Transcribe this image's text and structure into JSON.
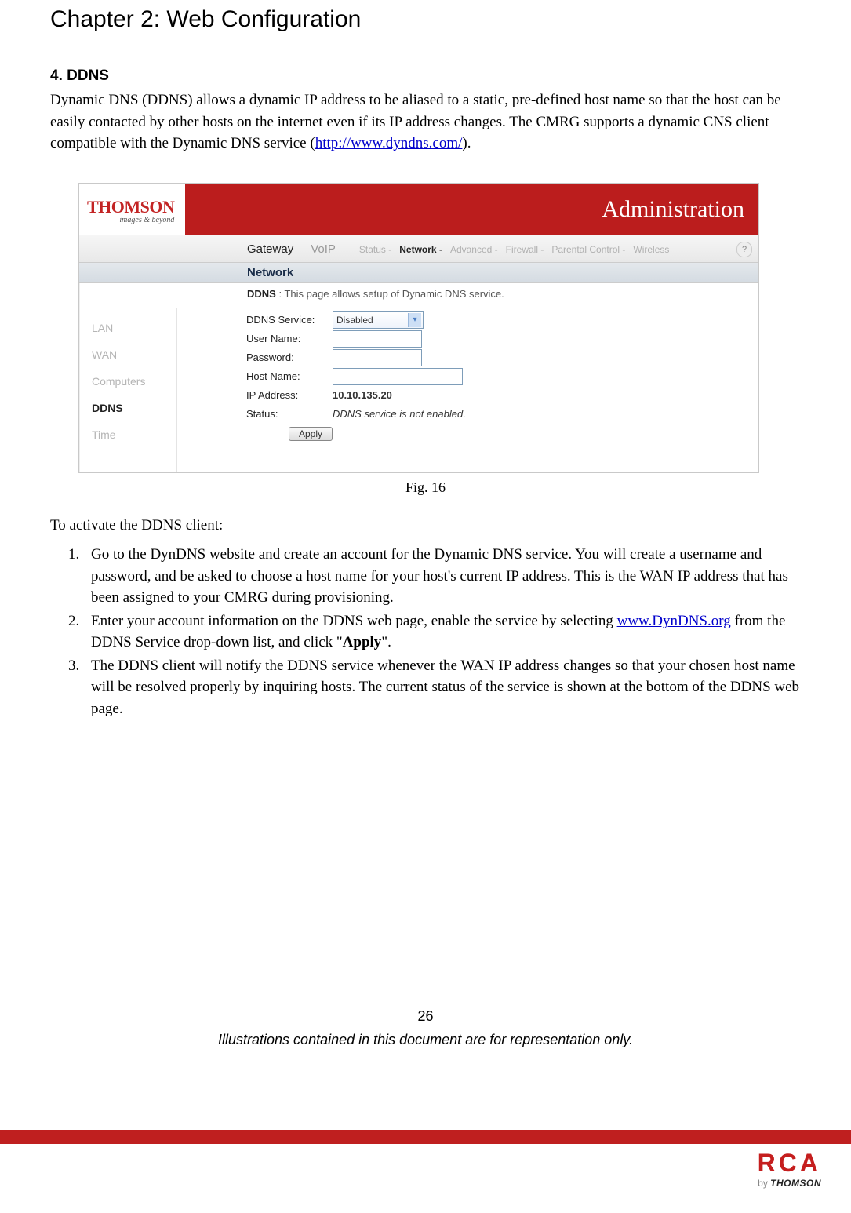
{
  "chapter_title": "Chapter 2: Web Configuration",
  "section_title": "4. DDNS",
  "para_intro_pre": "Dynamic DNS (DDNS) allows a dynamic IP address to be aliased to a static, pre-defined host name so that the host can be easily contacted by other hosts on the internet even if its IP address changes.    The CMRG supports a dynamic CNS client compatible with the Dynamic DNS service (",
  "para_intro_link": "http://www.dyndns.com/",
  "para_intro_post": ").",
  "fig": {
    "logo_main": "THOMSON",
    "logo_sub": "images & beyond",
    "admin_title": "Administration",
    "top_tabs": {
      "gateway": "Gateway",
      "voip": "VoIP"
    },
    "sub_tabs": {
      "status": "Status -",
      "network": "Network -",
      "advanced": "Advanced -",
      "firewall": "Firewall -",
      "parental": "Parental Control -",
      "wireless": "Wireless"
    },
    "help_label": "?",
    "section_banner": "Network",
    "desc_bold": "DDNS",
    "desc_rest": " :  This page allows setup of Dynamic DNS service.",
    "leftnav": {
      "lan": "LAN",
      "wan": "WAN",
      "computers": "Computers",
      "ddns": "DDNS",
      "time": "Time"
    },
    "form": {
      "ddns_service_label": "DDNS Service:",
      "ddns_service_value": "Disabled",
      "user_name_label": "User Name:",
      "user_name_value": "",
      "password_label": "Password:",
      "password_value": "",
      "host_name_label": "Host Name:",
      "host_name_value": "",
      "ip_address_label": "IP Address:",
      "ip_address_value": "10.10.135.20",
      "status_label": "Status:",
      "status_value": "DDNS service is not enabled.",
      "apply": "Apply"
    },
    "caption": "Fig. 16"
  },
  "activate_lead": "To activate the DDNS client:",
  "steps": {
    "s1": "Go to the DynDNS website and create an account for the Dynamic DNS service. You will create a username and password, and be asked to choose a host name for your host's current IP address. This is the WAN IP address that has been assigned to your CMRG during provisioning.",
    "s2_pre": "Enter your account information on the DDNS web page, enable the service by selecting ",
    "s2_link": "www.DynDNS.org",
    "s2_mid": " from the DDNS Service drop-down list, and click \"",
    "s2_bold": "Apply",
    "s2_post": "\".",
    "s3": "The DDNS client will notify the DDNS service whenever the WAN IP address changes so that your chosen host name will be resolved properly by inquiring hosts. The current status of the service is shown at the bottom of the DDNS web page."
  },
  "page_number": "26",
  "footer_note": "Illustrations contained in this document are for representation only.",
  "bottom_logo": {
    "rca": "RCA",
    "by": "by ",
    "thomson": "THOMSON"
  }
}
